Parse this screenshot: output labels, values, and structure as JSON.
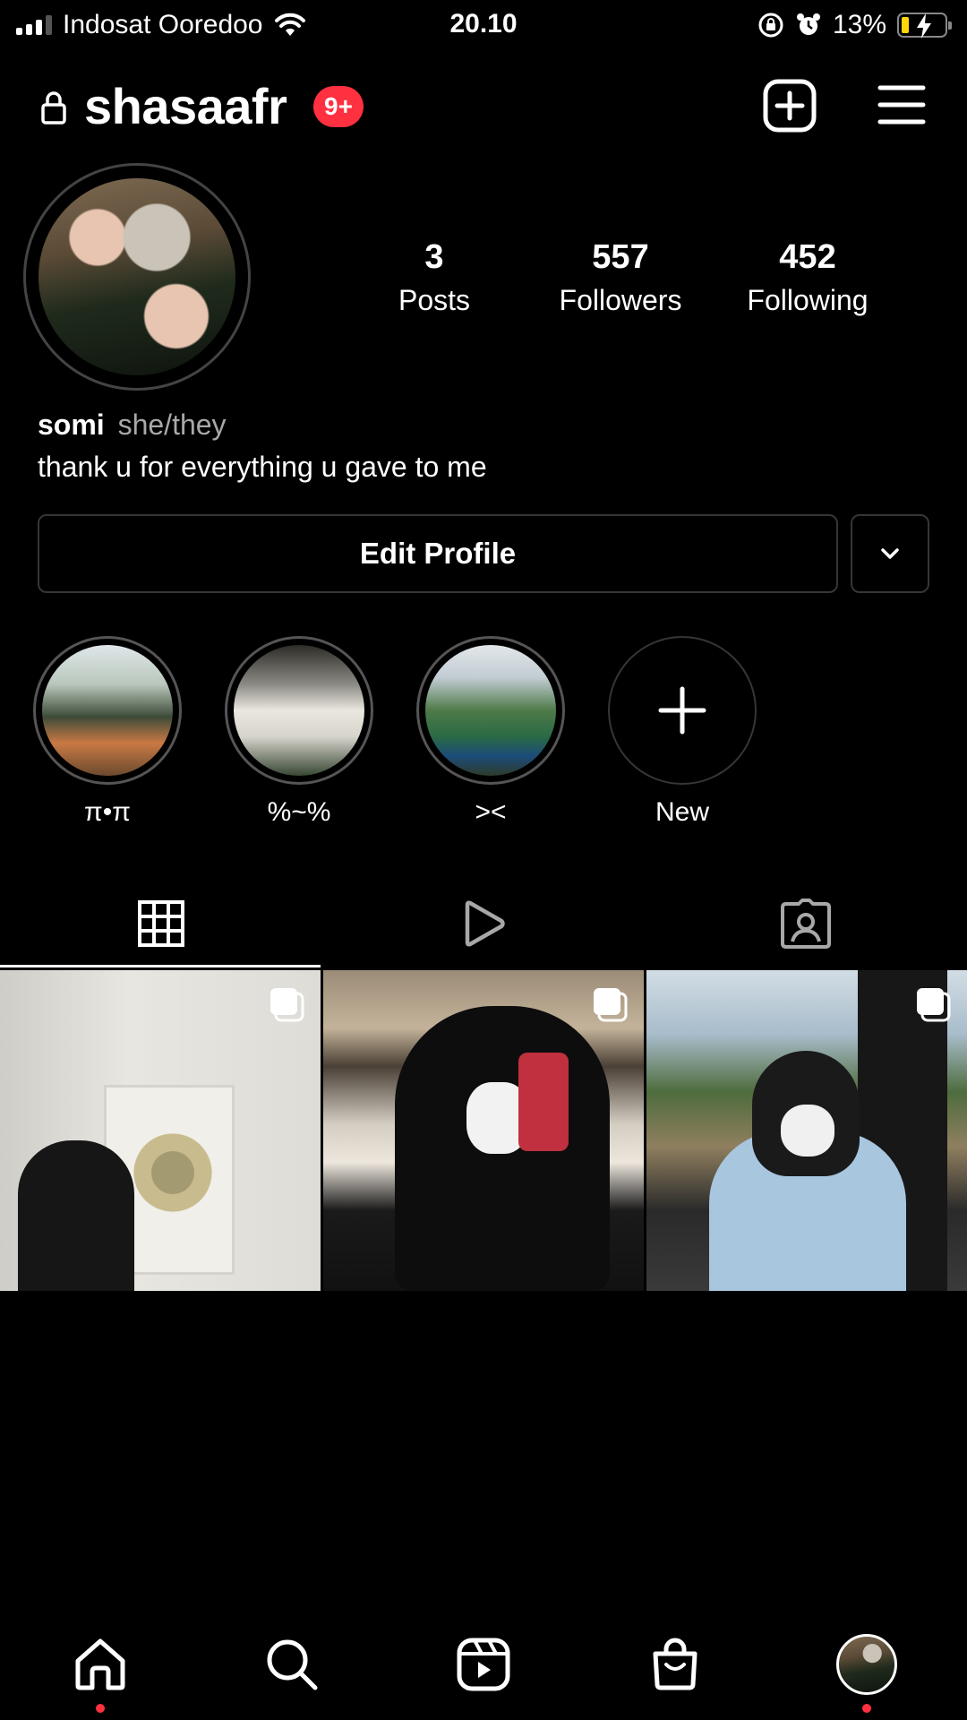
{
  "status_bar": {
    "carrier": "Indosat Ooredoo",
    "time": "20.10",
    "battery_percent": "13%",
    "signal_bars": 3,
    "signal_max": 4
  },
  "header": {
    "username": "shasaafr",
    "notification_badge": "9+"
  },
  "profile": {
    "stats": {
      "posts_count": "3",
      "posts_label": "Posts",
      "followers_count": "557",
      "followers_label": "Followers",
      "following_count": "452",
      "following_label": "Following"
    },
    "name": "somi",
    "pronouns": "she/they",
    "bio": "thank u for everything u gave to me",
    "edit_button_label": "Edit Profile"
  },
  "highlights": [
    {
      "label": "π•π"
    },
    {
      "label": "%~%"
    },
    {
      "label": "><"
    },
    {
      "label": "New"
    }
  ],
  "tabs": [
    {
      "icon": "grid-icon",
      "active": true
    },
    {
      "icon": "reels-icon",
      "active": false
    },
    {
      "icon": "tagged-icon",
      "active": false
    }
  ],
  "posts": [
    {
      "multi": true
    },
    {
      "multi": true
    },
    {
      "multi": true
    }
  ],
  "bottom_nav": [
    {
      "icon": "home-icon",
      "active": true,
      "dot": true
    },
    {
      "icon": "search-icon",
      "active": false,
      "dot": false
    },
    {
      "icon": "reels-icon",
      "active": false,
      "dot": false
    },
    {
      "icon": "shop-icon",
      "active": false,
      "dot": false
    },
    {
      "icon": "profile-avatar",
      "active": false,
      "dot": true
    }
  ],
  "colors": {
    "background": "#000000",
    "text": "#ffffff",
    "secondary_text": "#a8a8a8",
    "badge": "#ff3040",
    "border": "#363636",
    "battery_fill": "#ffd60a"
  }
}
